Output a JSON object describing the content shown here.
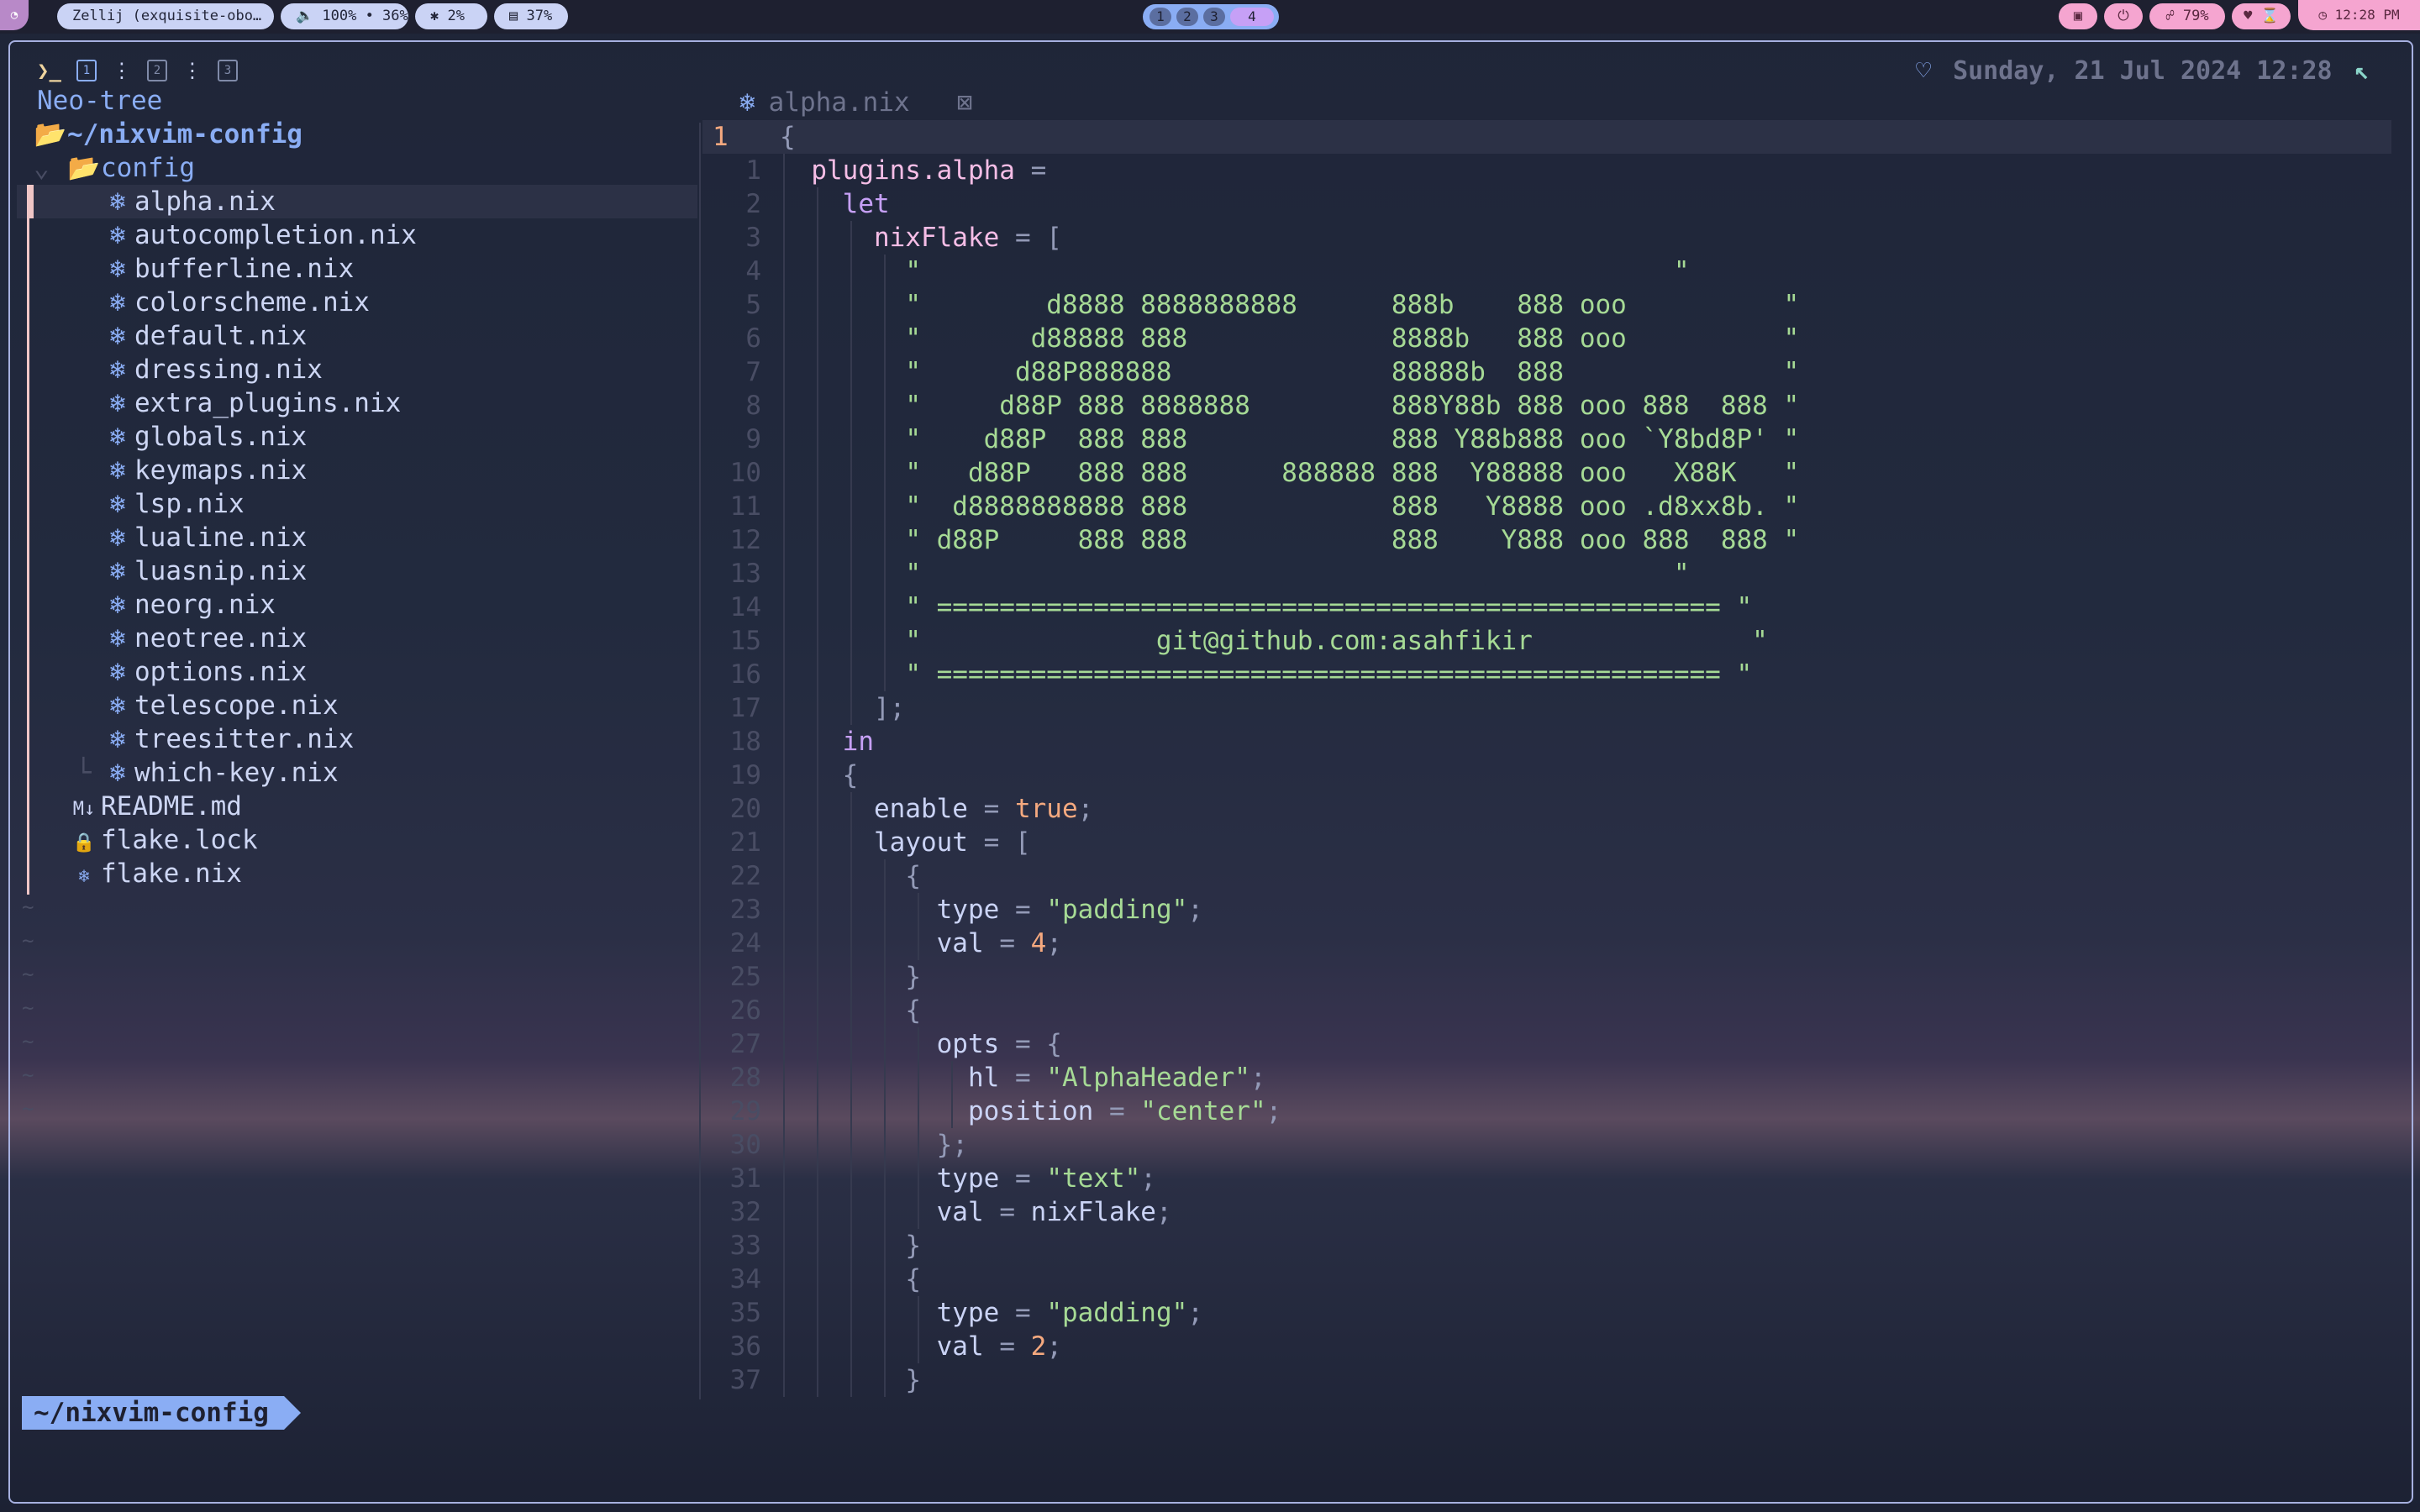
{
  "topbar": {
    "session": "Zellij (exquisite-obo…",
    "volume": "🔈 100% • 36%",
    "cpu": "✱  2%",
    "mem": "▤ 37%",
    "workspaces": [
      "1",
      "2",
      "3",
      "4"
    ],
    "right_pills": [
      "▣",
      "⏻",
      "☍ 79%",
      "♥ ⌛"
    ],
    "clock": "◷ 12:28 PM"
  },
  "tabs": {
    "prompt_icon": "❯_",
    "items": [
      "1",
      "2",
      "3"
    ]
  },
  "datetime": "Sunday, 21 Jul 2024 12:28",
  "tree": {
    "title": "Neo-tree",
    "root": "~/nixvim-config",
    "folder": "config",
    "files": [
      "alpha.nix",
      "autocompletion.nix",
      "bufferline.nix",
      "colorscheme.nix",
      "default.nix",
      "dressing.nix",
      "extra_plugins.nix",
      "globals.nix",
      "keymaps.nix",
      "lsp.nix",
      "lualine.nix",
      "luasnip.nix",
      "neorg.nix",
      "neotree.nix",
      "options.nix",
      "telescope.nix",
      "treesitter.nix",
      "which-key.nix"
    ],
    "root_files": [
      {
        "icon": "M↓",
        "name": "README.md"
      },
      {
        "icon": "🔒",
        "name": "flake.lock"
      },
      {
        "icon": "❄",
        "name": "flake.nix"
      }
    ],
    "tildes": [
      "~",
      "~",
      "~",
      "~",
      "~",
      "~",
      "~"
    ]
  },
  "buffer": {
    "name": "alpha.nix",
    "close_icon": "⊠"
  },
  "code": {
    "line_numbers": [
      "1",
      "1",
      "2",
      "3",
      "4",
      "5",
      "6",
      "7",
      "8",
      "9",
      "10",
      "11",
      "12",
      "13",
      "14",
      "15",
      "16",
      "17",
      "18",
      "19",
      "20",
      "21",
      "22",
      "23",
      "24",
      "25",
      "26",
      "27",
      "28",
      "29",
      "30",
      "31",
      "32",
      "33",
      "34",
      "35",
      "36",
      "37"
    ],
    "ascii": [
      "\"                                                \"",
      "\"        d8888 8888888888      888b    888 ooo          \"",
      "\"       d88888 888             8888b   888 ooo          \"",
      "\"      d88P888888              88888b  888              \"",
      "\"     d88P 888 8888888         888Y88b 888 ooo 888  888 \"",
      "\"    d88P  888 888             888 Y88b888 ooo `Y8bd8P' \"",
      "\"   d88P   888 888      888888 888  Y88888 ooo   X88K   \"",
      "\"  d8888888888 888             888   Y8888 ooo .d8xx8b. \"",
      "\" d88P     888 888             888    Y888 ooo 888  888 \"",
      "\"                                                \"",
      "\" ================================================== \"",
      "\"               git@github.com:asahfikir              \"",
      "\" ================================================== \""
    ]
  },
  "status": {
    "path": "~/nixvim-config"
  }
}
